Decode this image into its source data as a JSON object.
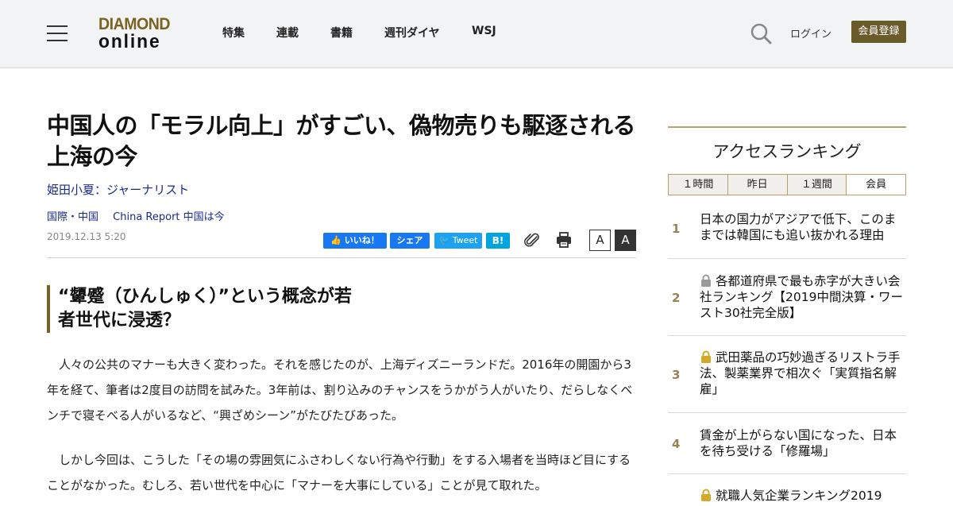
{
  "header": {
    "logo_line1": "DIAMOND",
    "logo_line2": "online",
    "nav": [
      "特集",
      "連載",
      "書籍",
      "週刊ダイヤ",
      "WSJ"
    ],
    "login": "ログイン",
    "register": "会員登録"
  },
  "article": {
    "title": "中国人の「モラル向上」がすごい、偽物売りも駆逐される上海の今",
    "author": "姫田小夏：ジャーナリスト",
    "category1": "国際・中国",
    "category2": "China Report 中国は今",
    "date": "2019.12.13 5:20",
    "share": {
      "like": "いいね！",
      "share": "シェア",
      "tweet": "Tweet",
      "hatena": "B!"
    },
    "font_small": "A",
    "font_large": "A",
    "subheading": "“顰蹙（ひんしゅく）”という概念が若者世代に浸透？",
    "paragraph1": "　人々の公共のマナーも大きく変わった。それを感じたのが、上海ディズニーランドだ。2016年の開園から3年を経て、筆者は2度目の訪問を試みた。3年前は、割り込みのチャンスをうかがう人がいたり、だらしなくベンチで寝そべる人がいるなど、“興ざめシーン”がたびたびあった。",
    "paragraph2": "　しかし今回は、こうした「その場の雰囲気にふさわしくない行為や行動」をする入場者を当時ほど目にすることがなかった。むしろ、若い世代を中心に「マナーを大事にしている」ことが見て取れた。"
  },
  "ranking": {
    "title": "アクセスランキング",
    "tabs": [
      "１時間",
      "昨日",
      "１週間",
      "会員"
    ],
    "items": [
      {
        "rank": "1",
        "locked": false,
        "text": "日本の国力がアジアで低下、このままでは韓国にも追い抜かれる理由"
      },
      {
        "rank": "2",
        "locked": true,
        "text": "各都道府県で最も赤字が大きい会社ランキング【2019中間決算・ワースト30社完全版】"
      },
      {
        "rank": "3",
        "locked": true,
        "text": "武田薬品の巧妙過ぎるリストラ手法、製薬業界で相次ぐ「実質指名解雇」"
      },
      {
        "rank": "4",
        "locked": false,
        "text": "賃金が上がらない国になった、日本を待ち受ける「修羅場」"
      },
      {
        "rank": "5",
        "locked": true,
        "text": "就職人気企業ランキング2019"
      }
    ]
  },
  "colors": {
    "brand_gold": "#7a6320",
    "link_blue": "#1a2a8c",
    "lock_gray": "#9a9a9a",
    "lock_gold": "#d4a92a"
  }
}
